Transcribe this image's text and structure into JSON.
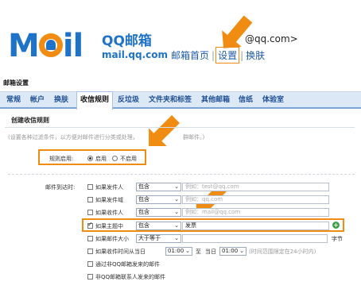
{
  "brand": {
    "cn": "QQ邮箱",
    "en": "mail.qq.com"
  },
  "header": {
    "account": "@qq.com>",
    "links": [
      "邮箱首页",
      "设置",
      "换肤"
    ],
    "separator": "|"
  },
  "page_title": "邮箱设置",
  "tabs": [
    "常规",
    "帐户",
    "换肤",
    "收信规则",
    "反垃圾",
    "文件夹和标签",
    "其他邮箱",
    "信纸",
    "体验室"
  ],
  "active_tab": "收信规则",
  "section": {
    "title": "创建收信规则",
    "description": "(设置各种过滤条件，以方便对邮件进行分类或处理，",
    "description_tail": "群邮件。)"
  },
  "rule_enable": {
    "label": "规则启用:",
    "options": [
      "启用",
      "不启用"
    ],
    "selected": "启用"
  },
  "conditions": {
    "label": "邮件到达时:",
    "rows": [
      {
        "check": "如果发件人",
        "checked": false,
        "op": "包含",
        "placeholder": "例如：test@qq.com",
        "value": ""
      },
      {
        "check": "如果发件域",
        "checked": false,
        "op": "包含",
        "placeholder": "例如：qq.com",
        "value": ""
      },
      {
        "check": "如果收件人",
        "checked": false,
        "op": "包含",
        "placeholder": "例如：mail@qq.com",
        "value": ""
      },
      {
        "check": "如果主题中",
        "checked": true,
        "op": "包含",
        "placeholder": "",
        "value": "发票"
      }
    ],
    "size": {
      "check": "如果邮件大小",
      "op": "大于等于",
      "unit": "字节"
    },
    "time": {
      "check": "如果收件时间从当日",
      "from": "01:00",
      "to_label": "至",
      "to_prefix": "当日",
      "to": "01:00",
      "hint": "(时间范围限定在24小时内)"
    },
    "extra": [
      "通过非QQ邮箱发来的邮件",
      "非QQ邮箱联系人发来的邮件"
    ]
  },
  "colors": {
    "accent": "#f08c12",
    "brand": "#1e73c9",
    "tabbar": "#dce8f6",
    "link": "#1e5aa8"
  }
}
